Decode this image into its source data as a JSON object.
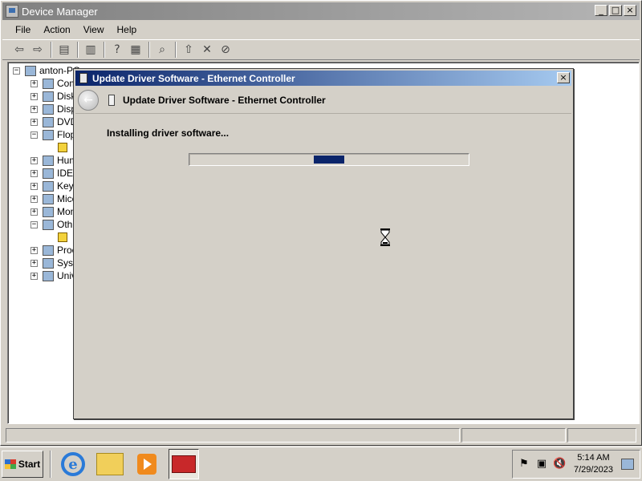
{
  "window": {
    "title": "Device Manager",
    "caption_buttons": [
      "_",
      "□",
      "×"
    ]
  },
  "menu": [
    "File",
    "Action",
    "View",
    "Help"
  ],
  "toolbar": [
    "back",
    "forward",
    "properties",
    "show-hide",
    "help",
    "scan",
    "update-driver",
    "uninstall",
    "disable"
  ],
  "tree": {
    "root": "anton-PC",
    "items": [
      "Com",
      "Disk",
      "Disp",
      "DVD",
      "Flop",
      "",
      "Hum",
      "IDE",
      "Key",
      "Mice",
      "Mon",
      "Oth",
      "",
      "Proc",
      "Syst",
      "Univ"
    ]
  },
  "dialog": {
    "title": "Update Driver Software - Ethernet Controller",
    "header_title": "Update Driver Software - Ethernet Controller",
    "message": "Installing driver software...",
    "close_label": "×",
    "progress": 0.08
  },
  "taskbar": {
    "start_label": "Start",
    "time": "5:14 AM",
    "date": "7/29/2023"
  }
}
